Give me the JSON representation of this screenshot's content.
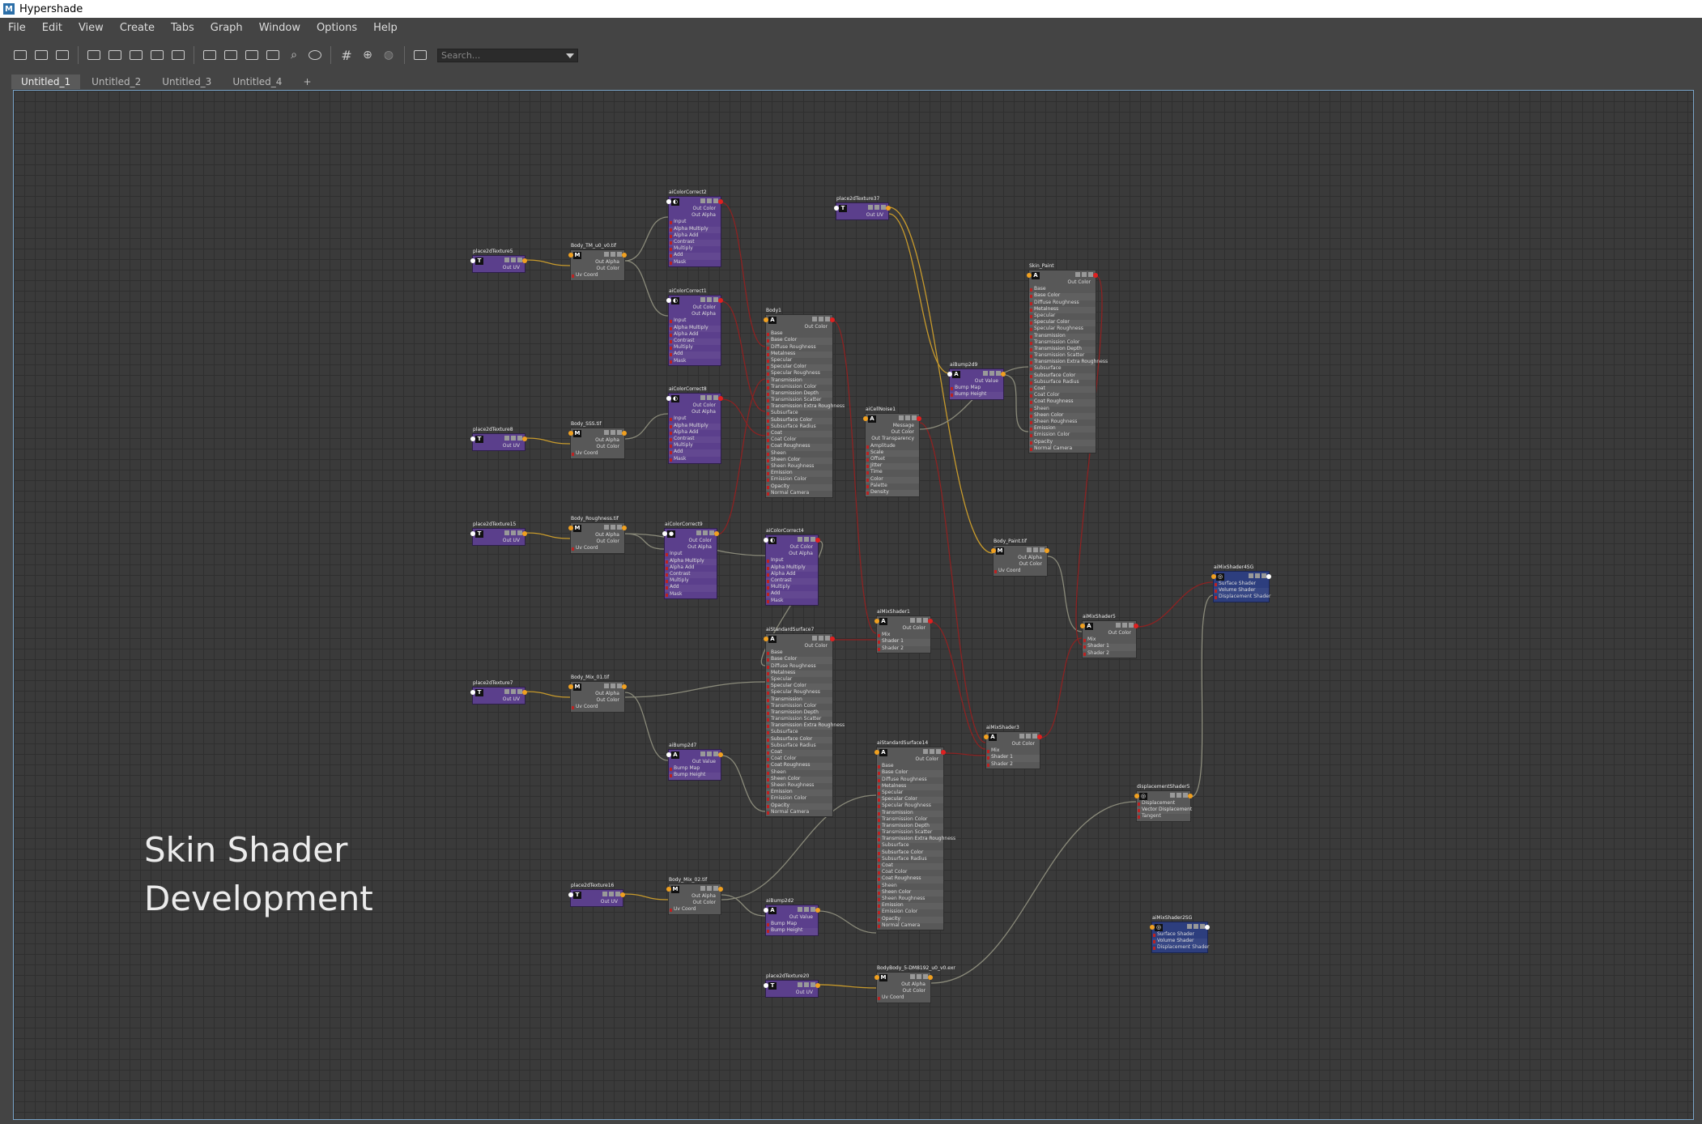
{
  "window": {
    "title": "Hypershade",
    "logo": "M"
  },
  "menu": [
    "File",
    "Edit",
    "View",
    "Create",
    "Tabs",
    "Graph",
    "Window",
    "Options",
    "Help"
  ],
  "toolbar": {
    "search_placeholder": "Search..."
  },
  "tabs": [
    "Untitled_1",
    "Untitled_2",
    "Untitled_3",
    "Untitled_4",
    "+"
  ],
  "active_tab": "Untitled_1",
  "caption": {
    "line1": "Skin Shader",
    "line2": "Development"
  },
  "colors": {
    "wire_yellow": "#c79a2c",
    "wire_red": "#8c2222",
    "wire_gray": "#8a8a7a",
    "port_orange": "#f0a020",
    "port_red": "#e02020",
    "accent": "#7aa4c8"
  },
  "nodes": [
    {
      "id": "p2d5",
      "label": "place2dTexture5",
      "color": "purple",
      "icon": "T",
      "outs": [
        "Out UV"
      ],
      "rows": []
    },
    {
      "id": "bodyTM",
      "label": "Body_TM_u0_v0.tif",
      "color": "gray",
      "icon": "M",
      "outs": [
        "Out Alpha",
        "Out Color"
      ],
      "rows": [
        "Uv Coord"
      ]
    },
    {
      "id": "cc2",
      "label": "aiColorCorrect2",
      "color": "purple",
      "icon": "◐",
      "outs": [
        "Out Color",
        "Out Alpha"
      ],
      "rows": [
        "Input",
        "Alpha Multiply",
        "Alpha Add",
        "Contrast",
        "Multiply",
        "Add",
        "Mask"
      ]
    },
    {
      "id": "cc1",
      "label": "aiColorCorrect1",
      "color": "purple",
      "icon": "◐",
      "outs": [
        "Out Color",
        "Out Alpha"
      ],
      "rows": [
        "Input",
        "Alpha Multiply",
        "Alpha Add",
        "Contrast",
        "Multiply",
        "Add",
        "Mask"
      ]
    },
    {
      "id": "p2d8",
      "label": "place2dTexture8",
      "color": "purple",
      "icon": "T",
      "outs": [
        "Out UV"
      ],
      "rows": []
    },
    {
      "id": "bodySSS",
      "label": "Body_SSS.tif",
      "color": "gray",
      "icon": "M",
      "outs": [
        "Out Alpha",
        "Out Color"
      ],
      "rows": [
        "Uv Coord"
      ]
    },
    {
      "id": "cc8",
      "label": "aiColorCorrect8",
      "color": "purple",
      "icon": "◐",
      "outs": [
        "Out Color",
        "Out Alpha"
      ],
      "rows": [
        "Input",
        "Alpha Multiply",
        "Alpha Add",
        "Contrast",
        "Multiply",
        "Add",
        "Mask"
      ]
    },
    {
      "id": "p2d15",
      "label": "place2dTexture15",
      "color": "purple",
      "icon": "T",
      "outs": [
        "Out UV"
      ],
      "rows": []
    },
    {
      "id": "bodyRough",
      "label": "Body_Roughness.tif",
      "color": "gray",
      "icon": "M",
      "outs": [
        "Out Alpha",
        "Out Color"
      ],
      "rows": [
        "Uv Coord"
      ]
    },
    {
      "id": "cc9",
      "label": "aiColorCorrect9",
      "color": "purple",
      "icon": "●",
      "outs": [
        "Out Color",
        "Out Alpha"
      ],
      "rows": [
        "Input",
        "Alpha Multiply",
        "Alpha Add",
        "Contrast",
        "Multiply",
        "Add",
        "Mask"
      ]
    },
    {
      "id": "p2d7",
      "label": "place2dTexture7",
      "color": "purple",
      "icon": "T",
      "outs": [
        "Out UV"
      ],
      "rows": []
    },
    {
      "id": "bodyMix01",
      "label": "Body_Mix_01.tif",
      "color": "gray",
      "icon": "M",
      "outs": [
        "Out Alpha",
        "Out Color"
      ],
      "rows": [
        "Uv Coord"
      ]
    },
    {
      "id": "bump7",
      "label": "aiBump2d7",
      "color": "purple",
      "icon": "A",
      "outs": [
        "Out Value"
      ],
      "rows": [
        "Bump Map",
        "Bump Height"
      ]
    },
    {
      "id": "p2d16",
      "label": "place2dTexture16",
      "color": "purple",
      "icon": "T",
      "outs": [
        "Out UV"
      ],
      "rows": []
    },
    {
      "id": "bodyMix02",
      "label": "Body_Mix_02.tif",
      "color": "gray",
      "icon": "M",
      "outs": [
        "Out Alpha",
        "Out Color"
      ],
      "rows": [
        "Uv Coord"
      ]
    },
    {
      "id": "bump2",
      "label": "aiBump2d2",
      "color": "purple",
      "icon": "A",
      "outs": [
        "Out Value"
      ],
      "rows": [
        "Bump Map",
        "Bump Height"
      ]
    },
    {
      "id": "p2d20",
      "label": "place2dTexture20",
      "color": "purple",
      "icon": "T",
      "outs": [
        "Out UV"
      ],
      "rows": []
    },
    {
      "id": "bodyExr",
      "label": "BodyBody_5-DM8192_u0_v0.exr",
      "color": "gray",
      "icon": "M",
      "outs": [
        "Out Alpha",
        "Out Color"
      ],
      "rows": [
        "Uv Coord"
      ]
    },
    {
      "id": "body1",
      "label": "Body1",
      "color": "gray",
      "icon": "A",
      "outs": [
        "Out Color"
      ],
      "rows": [
        "Base",
        "Base Color",
        "Diffuse Roughness",
        "Metalness",
        "Specular",
        "Specular Color",
        "Specular Roughness",
        "Transmission",
        "Transmission Color",
        "Transmission Depth",
        "Transmission Scatter",
        "Transmission Extra Roughness",
        "Subsurface",
        "Subsurface Color",
        "Subsurface Radius",
        "Coat",
        "Coat Color",
        "Coat Roughness",
        "Sheen",
        "Sheen Color",
        "Sheen Roughness",
        "Emission",
        "Emission Color",
        "Opacity",
        "Normal Camera"
      ]
    },
    {
      "id": "cc4",
      "label": "aiColorCorrect4",
      "color": "purple",
      "icon": "◐",
      "outs": [
        "Out Color",
        "Out Alpha"
      ],
      "rows": [
        "Input",
        "Alpha Multiply",
        "Alpha Add",
        "Contrast",
        "Multiply",
        "Add",
        "Mask"
      ]
    },
    {
      "id": "ss7",
      "label": "aiStandardSurface7",
      "color": "gray",
      "icon": "A",
      "outs": [
        "Out Color"
      ],
      "rows": [
        "Base",
        "Base Color",
        "Diffuse Roughness",
        "Metalness",
        "Specular",
        "Specular Color",
        "Specular Roughness",
        "Transmission",
        "Transmission Color",
        "Transmission Depth",
        "Transmission Scatter",
        "Transmission Extra Roughness",
        "Subsurface",
        "Subsurface Color",
        "Subsurface Radius",
        "Coat",
        "Coat Color",
        "Coat Roughness",
        "Sheen",
        "Sheen Color",
        "Sheen Roughness",
        "Emission",
        "Emission Color",
        "Opacity",
        "Normal Camera"
      ]
    },
    {
      "id": "p2d37",
      "label": "place2dTexture37",
      "color": "purple",
      "icon": "T",
      "outs": [
        "Out UV"
      ],
      "rows": []
    },
    {
      "id": "cellnoise",
      "label": "aiCellNoise1",
      "color": "gray",
      "icon": "A",
      "outs": [
        "Message",
        "Out Color",
        "Out Transparency"
      ],
      "rows": [
        "Amplitude",
        "Scale",
        "Offset",
        "Jitter",
        "Time",
        "Color",
        "Palette",
        "Density"
      ]
    },
    {
      "id": "mix1",
      "label": "aiMixShader1",
      "color": "gray",
      "icon": "A",
      "outs": [
        "Out Color"
      ],
      "rows": [
        "Mix",
        "Shader 1",
        "Shader 2"
      ]
    },
    {
      "id": "ss14",
      "label": "aiStandardSurface14",
      "color": "gray",
      "icon": "A",
      "outs": [
        "Out Color"
      ],
      "rows": [
        "Base",
        "Base Color",
        "Diffuse Roughness",
        "Metalness",
        "Specular",
        "Specular Color",
        "Specular Roughness",
        "Transmission",
        "Transmission Color",
        "Transmission Depth",
        "Transmission Scatter",
        "Transmission Extra Roughness",
        "Subsurface",
        "Subsurface Color",
        "Subsurface Radius",
        "Coat",
        "Coat Color",
        "Coat Roughness",
        "Sheen",
        "Sheen Color",
        "Sheen Roughness",
        "Emission",
        "Emission Color",
        "Opacity",
        "Normal Camera"
      ]
    },
    {
      "id": "bump9",
      "label": "aiBump2d9",
      "color": "purple",
      "icon": "A",
      "outs": [
        "Out Value"
      ],
      "rows": [
        "Bump Map",
        "Bump Height"
      ]
    },
    {
      "id": "skinpaint",
      "label": "Skin_Paint",
      "color": "gray",
      "icon": "A",
      "outs": [
        "Out Color"
      ],
      "rows": [
        "Base",
        "Base Color",
        "Diffuse Roughness",
        "Metalness",
        "Specular",
        "Specular Color",
        "Specular Roughness",
        "Transmission",
        "Transmission Color",
        "Transmission Depth",
        "Transmission Scatter",
        "Transmission Extra Roughness",
        "Subsurface",
        "Subsurface Color",
        "Subsurface Radius",
        "Coat",
        "Coat Color",
        "Coat Roughness",
        "Sheen",
        "Sheen Color",
        "Sheen Roughness",
        "Emission",
        "Emission Color",
        "Opacity",
        "Normal Camera"
      ]
    },
    {
      "id": "bodyPaint",
      "label": "Body_Paint.tif",
      "color": "gray",
      "icon": "M",
      "outs": [
        "Out Alpha",
        "Out Color"
      ],
      "rows": [
        "Uv Coord"
      ]
    },
    {
      "id": "mix3",
      "label": "aiMixShader3",
      "color": "gray",
      "icon": "A",
      "outs": [
        "Out Color"
      ],
      "rows": [
        "Mix",
        "Shader 1",
        "Shader 2"
      ]
    },
    {
      "id": "mix5",
      "label": "aiMixShader5",
      "color": "gray",
      "icon": "A",
      "outs": [
        "Out Color"
      ],
      "rows": [
        "Mix",
        "Shader 1",
        "Shader 2"
      ]
    },
    {
      "id": "disp5",
      "label": "displacementShader5",
      "color": "gray",
      "icon": "◎",
      "outs": [],
      "rows": [
        "Displacement",
        "Vector Displacement",
        "Tangent"
      ]
    },
    {
      "id": "sg",
      "label": "aiMixShader4SG",
      "color": "blue",
      "icon": "◎",
      "outs": [],
      "rows": [
        "Surface Shader",
        "Volume Shader",
        "Displacement Shader"
      ]
    },
    {
      "id": "sg2",
      "label": "aiMixShader2SG",
      "color": "blue",
      "icon": "◎",
      "outs": [],
      "rows": [
        "Surface Shader",
        "Volume Shader",
        "Displacement Shader"
      ]
    }
  ]
}
